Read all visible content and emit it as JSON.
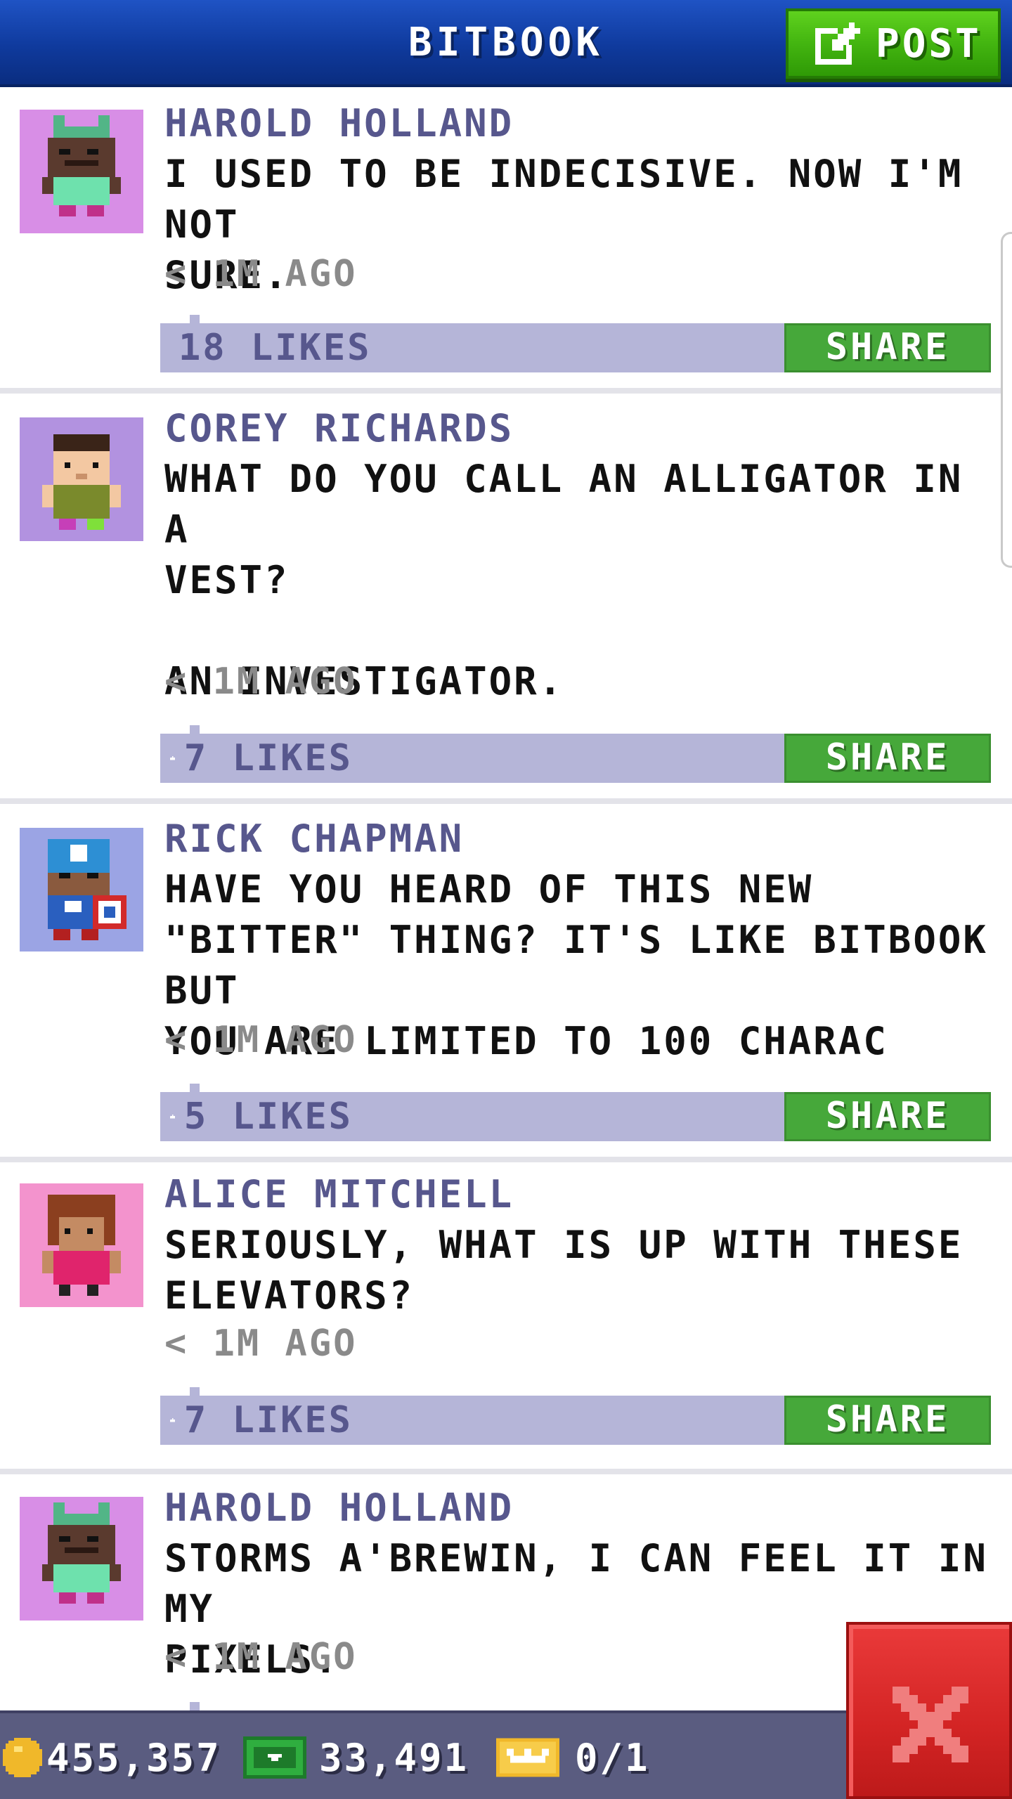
{
  "header": {
    "title": "BITBOOK",
    "post_label": "POST"
  },
  "feed": {
    "posts": [
      {
        "author": "HAROLD HOLLAND",
        "text": "I USED TO BE INDECISIVE. NOW I'M NOT\nSURE.",
        "time": "< 1M AGO",
        "likes": "18 LIKES",
        "share_label": "SHARE",
        "avatar": "bitizen-green-hat-avatar",
        "avatar_bg": "#d88ee6"
      },
      {
        "author": "COREY RICHARDS",
        "text": "WHAT DO YOU CALL AN ALLIGATOR IN A\nVEST?\n\nAN INVESTIGATOR.",
        "time": "< 1M AGO",
        "likes": "7 LIKES",
        "share_label": "SHARE",
        "avatar": "bitizen-olive-shirt-avatar",
        "avatar_bg": "#b292e0"
      },
      {
        "author": "RICK CHAPMAN",
        "text": "HAVE YOU HEARD OF THIS NEW\n\"BITTER\" THING? IT'S LIKE BITBOOK BUT\nYOU ARE LIMITED TO 100 CHARAC",
        "time": "< 1M AGO",
        "likes": "5 LIKES",
        "share_label": "SHARE",
        "avatar": "bitizen-captain-shield-avatar",
        "avatar_bg": "#9ba4e4"
      },
      {
        "author": "ALICE MITCHELL",
        "text": "SERIOUSLY, WHAT IS UP WITH THESE\nELEVATORS?",
        "time": "< 1M AGO",
        "likes": "7 LIKES",
        "share_label": "SHARE",
        "avatar": "bitizen-pink-shirt-avatar",
        "avatar_bg": "#f393cd"
      },
      {
        "author": "HAROLD HOLLAND",
        "text": "STORMS A'BREWIN, I CAN FEEL IT IN MY\nPIXELS.",
        "time": "< 1M AGO",
        "likes": "",
        "share_label": "",
        "avatar": "bitizen-green-hat-avatar",
        "avatar_bg": "#d88ee6"
      }
    ]
  },
  "footer": {
    "coins": "455,357",
    "bux": "33,491",
    "tickets": "0/1",
    "icons": [
      "coin-icon",
      "bux-icon",
      "vip-ticket-icon",
      "close-icon"
    ]
  },
  "colors": {
    "header_blue": "#0f3a9d",
    "post_green": "#43b510",
    "share_green": "#46a83a",
    "like_bar": "#b5b5d8",
    "author_text": "#57578d",
    "footer_bg": "#5a5c80",
    "close_red": "#d32424"
  }
}
